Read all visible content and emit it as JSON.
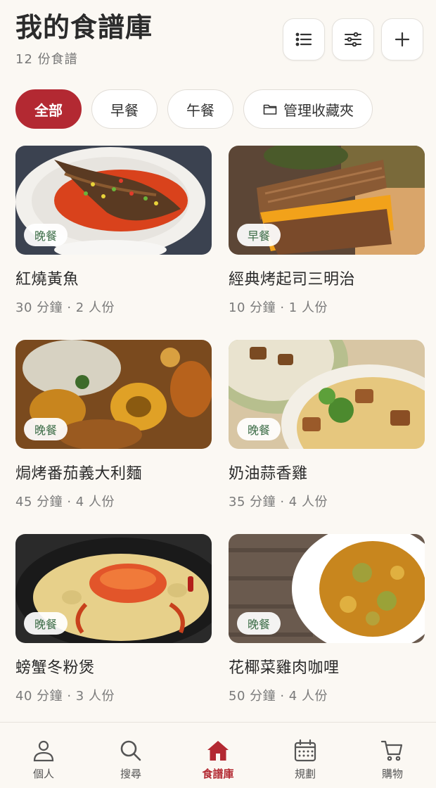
{
  "header": {
    "title": "我的食譜庫",
    "count": "12 份食譜",
    "actions": [
      {
        "icon": "list-icon"
      },
      {
        "icon": "filter-sliders-icon"
      },
      {
        "icon": "plus-icon"
      }
    ]
  },
  "filters": [
    {
      "label": "全部",
      "active": true
    },
    {
      "label": "早餐",
      "active": false
    },
    {
      "label": "午餐",
      "active": false
    },
    {
      "label": "管理收藏夾",
      "active": false,
      "icon": "folder-icon"
    }
  ],
  "recipes": [
    {
      "name": "紅燒黃魚",
      "meta": "30 分鐘 · 2 人份",
      "meal": "晚餐"
    },
    {
      "name": "經典烤起司三明治",
      "meta": "10 分鐘 · 1 人份",
      "meal": "早餐"
    },
    {
      "name": "焗烤番茄義大利麵",
      "meta": "45 分鐘 · 4 人份",
      "meal": "晚餐"
    },
    {
      "name": "奶油蒜香雞",
      "meta": "35 分鐘 · 4 人份",
      "meal": "晚餐"
    },
    {
      "name": "螃蟹冬粉煲",
      "meta": "40 分鐘 · 3 人份",
      "meal": "晚餐"
    },
    {
      "name": "花椰菜雞肉咖哩",
      "meta": "50 分鐘 · 4 人份",
      "meal": "晚餐"
    }
  ],
  "nav": [
    {
      "label": "個人",
      "icon": "person-icon",
      "active": false
    },
    {
      "label": "搜尋",
      "icon": "search-icon",
      "active": false
    },
    {
      "label": "食譜庫",
      "icon": "home-icon",
      "active": true
    },
    {
      "label": "規劃",
      "icon": "calendar-icon",
      "active": false
    },
    {
      "label": "購物",
      "icon": "cart-icon",
      "active": false
    }
  ],
  "colors": {
    "accent": "#b32932",
    "background": "#fbf8f3",
    "badge_text": "#3a6b45"
  }
}
